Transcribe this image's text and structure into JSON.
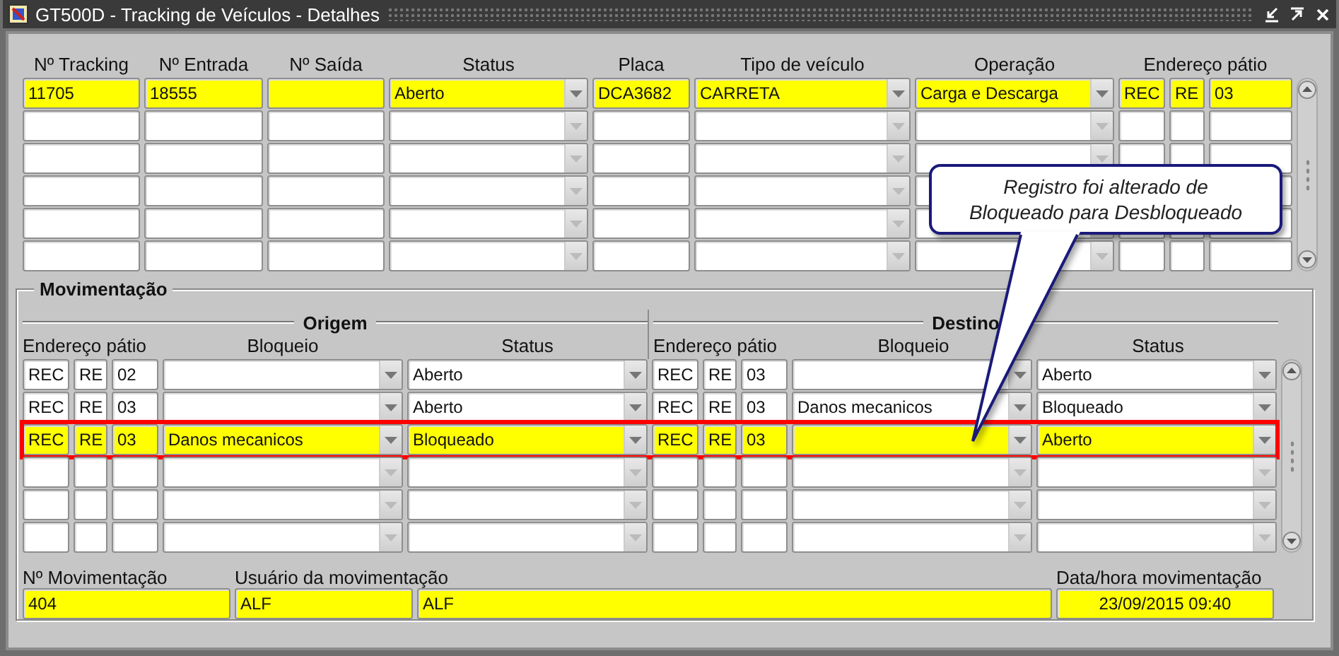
{
  "window": {
    "title": "GT500D - Tracking de Veículos - Detalhes"
  },
  "tracking": {
    "columns": [
      "Nº Tracking",
      "Nº Entrada",
      "Nº Saída",
      "Status",
      "Placa",
      "Tipo de veículo",
      "Operação"
    ],
    "address_header": "Endereço pátio",
    "rows": [
      {
        "selected": true,
        "tracking": "11705",
        "entrada": "18555",
        "status": "Aberto",
        "placa": "DCA3682",
        "tipo": "CARRETA",
        "operacao": "Carga e Descarga",
        "endereco": [
          "REC",
          "RE",
          "03"
        ]
      },
      {
        "selected": false
      },
      {
        "selected": false
      },
      {
        "selected": false
      },
      {
        "selected": false
      },
      {
        "selected": false
      }
    ]
  },
  "movimentacao": {
    "title": "Movimentação",
    "origem": {
      "heading": "Origem",
      "columns": [
        "Endereço pátio",
        "Bloqueio",
        "Status"
      ]
    },
    "destino": {
      "heading": "Destino",
      "columns": [
        "Endereço pátio",
        "Bloqueio",
        "Status"
      ]
    },
    "rows": [
      {
        "selected": false,
        "highlighted": false,
        "origem": {
          "endereco": [
            "REC",
            "RE",
            "02"
          ],
          "status": "Aberto"
        },
        "destino": {
          "endereco": [
            "REC",
            "RE",
            "03"
          ],
          "status": "Aberto"
        }
      },
      {
        "selected": false,
        "highlighted": false,
        "origem": {
          "endereco": [
            "REC",
            "RE",
            "03"
          ],
          "status": "Aberto"
        },
        "destino": {
          "endereco": [
            "REC",
            "RE",
            "03"
          ],
          "bloqueio": "Danos mecanicos",
          "status": "Bloqueado"
        }
      },
      {
        "selected": true,
        "highlighted": true,
        "origem": {
          "endereco": [
            "REC",
            "RE",
            "03"
          ],
          "bloqueio": "Danos mecanicos",
          "status": "Bloqueado"
        },
        "destino": {
          "endereco": [
            "REC",
            "RE",
            "03"
          ],
          "status": "Aberto"
        }
      },
      {
        "selected": false,
        "highlighted": false
      },
      {
        "selected": false,
        "highlighted": false
      },
      {
        "selected": false,
        "highlighted": false
      }
    ],
    "movement_number": {
      "label": "Nº Movimentação",
      "value": "404"
    },
    "user": {
      "label": "Usuário da movimentação",
      "code": "ALF",
      "name": "ALF"
    },
    "datetime": {
      "label": "Data/hora movimentação",
      "value": "23/09/2015 09:40"
    }
  },
  "callout": {
    "text": "Registro foi alterado de\nBloqueado para Desbloqueado"
  }
}
